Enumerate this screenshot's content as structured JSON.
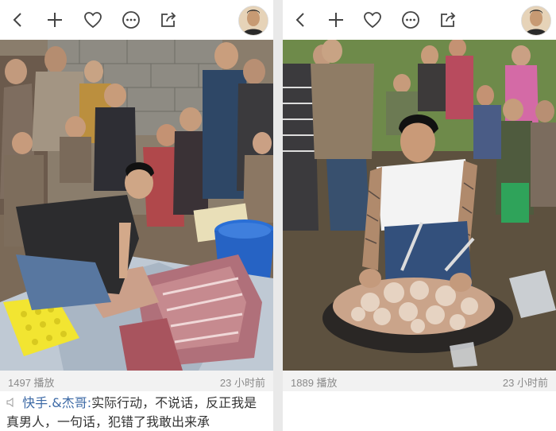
{
  "icons": {
    "back": "chevron-left-icon",
    "add": "plus-icon",
    "like": "heart-icon",
    "more": "more-circle-icon",
    "share": "share-icon",
    "speaker": "speaker-icon"
  },
  "colors": {
    "author_link": "#3d6aa6",
    "meta_text": "#8a8a8a",
    "caption_text": "#333333"
  },
  "left": {
    "plays": "1497 播放",
    "time": "23 小时前",
    "author": "快手.&杰哥:",
    "caption": "实际行动，不说话，反正我是真男人，一句话，犯错了我敢出来承"
  },
  "right": {
    "plays": "1889 播放",
    "time": "23 小时前"
  }
}
